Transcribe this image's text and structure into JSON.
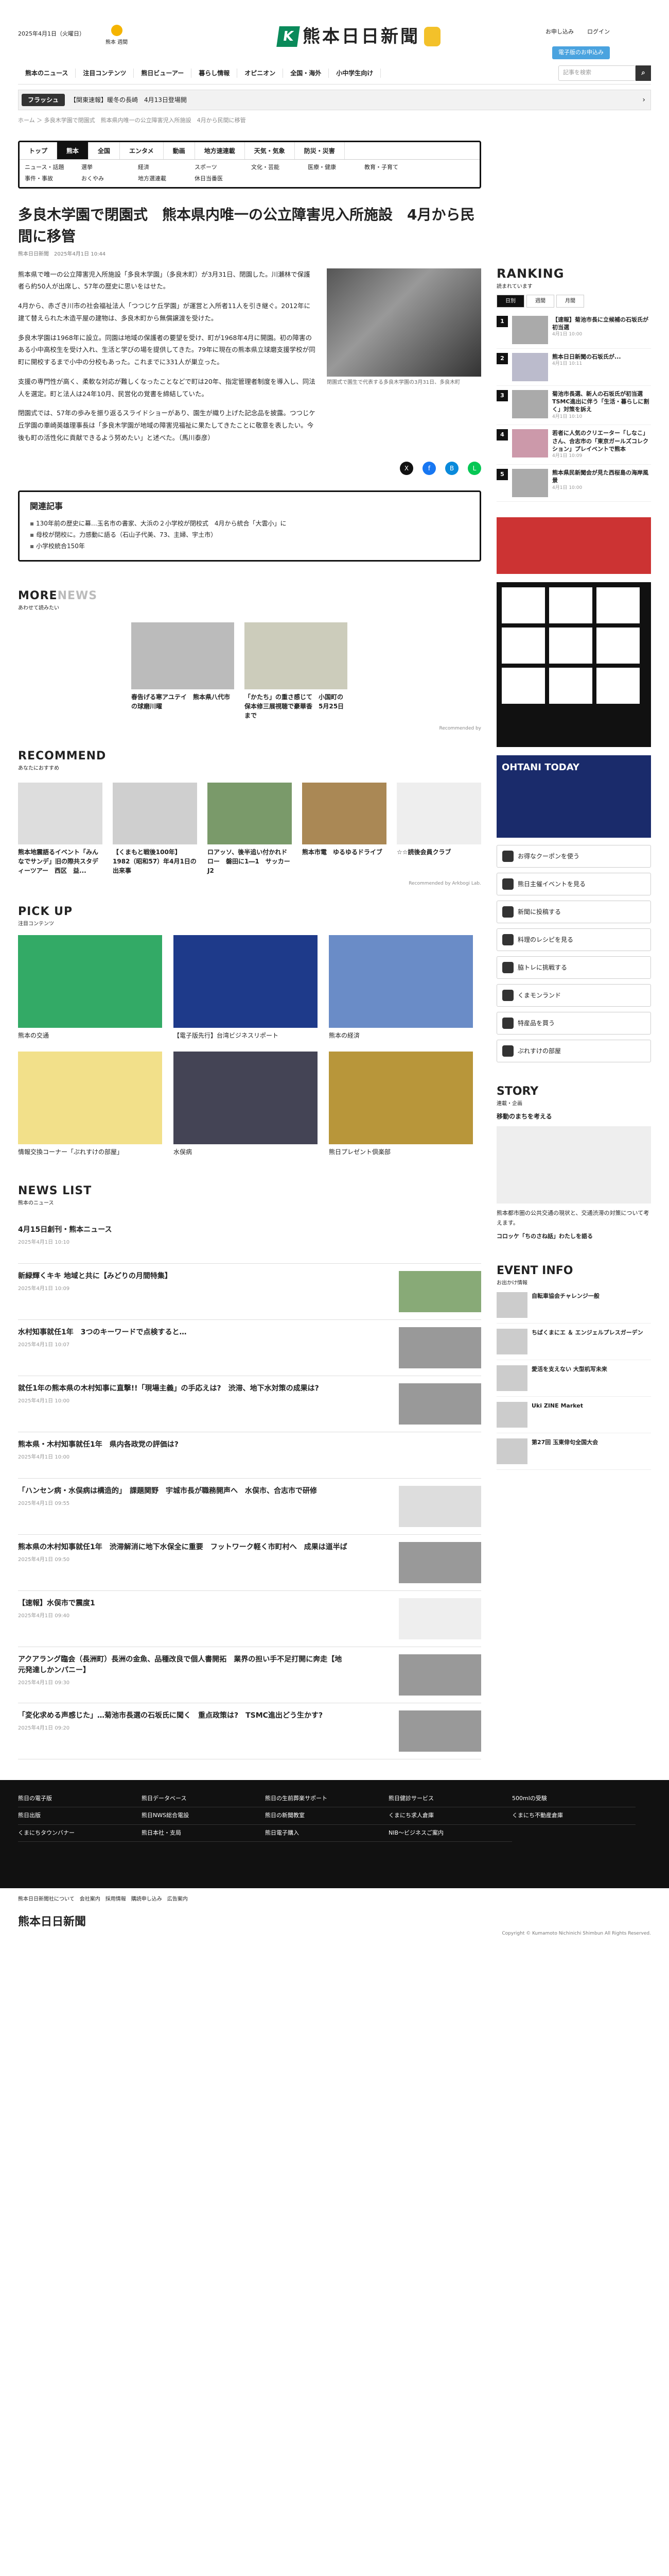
{
  "header": {
    "date": "2025年4月1日（火曜日）",
    "weather_city": "熊本",
    "weather_label": "週間",
    "logo_text": "熊本日日新聞",
    "link_login": "お申し込み",
    "link_member": "ログイン",
    "subscribe": "電子版のお申込み"
  },
  "nav": [
    "熊本のニュース",
    "注目コンテンツ",
    "熊日ビューアー",
    "暮らし情報",
    "オピニオン",
    "全国・海外",
    "小中学生向け"
  ],
  "search_placeholder": "記事を検索",
  "flash": {
    "label": "フラッシュ",
    "text": "【関東速報】暖冬の長崎　4月13日登場開"
  },
  "breadcrumb": "ホーム ＞ 多良木学園で閉園式　熊本県内唯一の公立障害児入所施設　4月から民間に移管",
  "cats": {
    "main": [
      "トップ",
      "熊本",
      "全国",
      "エンタメ",
      "動画",
      "地方速連載",
      "天気・気象",
      "防災・災害"
    ],
    "sub": [
      "ニュース・話題",
      "選挙",
      "経済",
      "スポーツ",
      "文化・芸能",
      "医療・健康",
      "教育・子育て",
      "事件・事故",
      "おくやみ",
      "地方選連載",
      "休日当番医"
    ]
  },
  "article": {
    "title": "多良木学園で閉園式　熊本県内唯一の公立障害児入所施設　4月から民間に移管",
    "meta": "熊本日日新聞　2025年4月1日 10:44",
    "paragraphs": [
      "熊本県で唯一の公立障害児入所施設「多良木学園」（多良木町）が3月31日、閉園した。川瀬林で保護者ら約50人が出席し、57年の歴史に思いをはせた。",
      "4月から、赤ざき川市の社会福祉法人「つつじケ丘学園」が運営と入所者11人を引き継ぐ。2012年に建て替えられた木造平屋の建物は、多良木町から無償譲渡を受けた。",
      "多良木学園は1968年に設立。同園は地域の保護者の要望を受け、町が1968年4月に開園。初の障害のある小中高校生を受け入れ、生活と学びの場を提供してきた。79年に現在の熊本県立球磨支援学校が同町に開校するまで小中の分校もあった。これまでに331人が巣立った。",
      "支援の専門性が高く、柔軟な対応が難しくなったことなどで町は20年、指定管理者制度を導入し、同法人を選定。町と法人は24年10月、民営化の覚書を締結していた。",
      "閉園式では、57年の歩みを振り返るスライドショーがあり、園生が織り上げた記念品を披露。つつじケ丘学園の車崎英雄理事長は「多良木学園が地域の障害児福祉に果たしてきたことに敬意を表したい。今後も町の活性化に貢献できるよう努めたい」と述べた。（馬川泰彦）"
    ],
    "photo_caption": "閉園式で園生で代表する多良木学園の3月31日、多良木町"
  },
  "related": {
    "title": "関連記事",
    "items": [
      "130年前の歴史に幕…玉名市の書家、大浜の２小学校が閉校式　4月から統合「大雲小」に",
      "母校が閉校に。力感動に語る（石山子代美、73、主婦、宇土市）",
      "小学校統合150年"
    ]
  },
  "more": {
    "title": "MORE",
    "title_light": "NEWS",
    "subtitle": "あわせて読みたい",
    "items": [
      {
        "title": "春告げる寒アユテイ　熊本県八代市の球磨川曜"
      },
      {
        "title": "「かたち」の重さ感じて　小国町の保本修三展視聴で豪華香　5月25日まで"
      }
    ],
    "credit": "Recommended by"
  },
  "recommend": {
    "title": "RECOMMEND",
    "subtitle": "あなたにおすすめ",
    "items": [
      {
        "title": "熊本地震語るイベント「みんなでサンデ」旧の際共スタディーツアー　西区　益..."
      },
      {
        "title": "【くまもと戦後100年】1982（昭和57）年4月1日の出来事"
      },
      {
        "title": "ロアッソ、後半追い付かれドロー　磐田に1―1　サッカーJ2"
      },
      {
        "title": "熊本市電　ゆるゆるドライブ"
      },
      {
        "title": "☆☆読後会員クラブ"
      }
    ],
    "credit": "Recommended by Arkbogi Lab."
  },
  "pickup": {
    "title": "PICK UP",
    "subtitle": "注目コンテンツ",
    "items": [
      "熊本の交通",
      "【電子版先行】台湾ビジネスリポート",
      "熊本の経済",
      "情報交換コーナー「ぷれすけの部屋」",
      "水俣病",
      "熊日プレゼント倶楽部"
    ]
  },
  "newslist": {
    "title": "NEWS LIST",
    "subtitle": "熊本のニュース",
    "items": [
      {
        "title": "4月15日創刊・熊本ニュース",
        "date": "2025年4月1日 10:10"
      },
      {
        "title": "新緑輝くキキ 地域と共に【みどりの月間特集】",
        "date": "2025年4月1日 10:09"
      },
      {
        "title": "水村知事就任1年　3つのキーワードで点検すると…",
        "date": "2025年4月1日 10:07"
      },
      {
        "title": "就任1年の熊本県の木村知事に直撃!!「現場主義」の手応えは?　渋滞、地下水対策の成果は?",
        "date": "2025年4月1日 10:00"
      },
      {
        "title": "熊本県・木村知事就任1年　県内各政党の評価は?",
        "date": "2025年4月1日 10:00"
      },
      {
        "title": "「ハンセン病・水俣病は構造的」　課題関野　宇城市長が職務開声へ　水俣市、合志市で研修",
        "date": "2025年4月1日 09:55"
      },
      {
        "title": "熊本県の木村知事就任1年　渋滞解消に地下水保全に重要　フットワーク軽く市町村へ　成果は道半ば",
        "date": "2025年4月1日 09:50"
      },
      {
        "title": "【速報】水俣市で震度1",
        "date": "2025年4月1日 09:40"
      },
      {
        "title": "アクアラング臨会（長洲町）長洲の金魚、品種改良で個人書開拓　業界の担い手不足打開に奔走【地元発達しかンパニー】",
        "date": "2025年4月1日 09:30"
      },
      {
        "title": "「変化求める声感じた」…菊池市長選の石坂氏に聞く　重点政策は?　TSMC進出どう生かす?",
        "date": "2025年4月1日 09:20"
      }
    ]
  },
  "ranking": {
    "title": "RANKING",
    "subtitle": "読まれています",
    "tabs": [
      "日別",
      "週間",
      "月間"
    ],
    "items": [
      {
        "title": "【速報】菊池市長に立候補の石坂氏が初当選",
        "date": "4月1日 10:00"
      },
      {
        "title": "熊本日日新聞の石坂氏が...",
        "date": "4月1日 10:11"
      },
      {
        "title": "菊池市長選、新人の石坂氏が初当選　TSMC進出に伴う「生活・暮らしに割く」対策を訴え",
        "date": "4月1日 10:10"
      },
      {
        "title": "若者に人気のクリエーター「しなこ」さん、合志市の「東京ガールズコレクション」プレイベントで熊本",
        "date": "4月1日 10:09"
      },
      {
        "title": "熊本県民新聞会が見た西桜島の海岸風景",
        "date": "4月1日 10:00"
      }
    ]
  },
  "otv": {
    "text": "OHTANI TODAY"
  },
  "menu": [
    "お得なクーポンを使う",
    "熊日主催イベントを見る",
    "新聞に投稿する",
    "料理のレシピを見る",
    "脇トレに挑戦する",
    "くまモンランド",
    "特産品を買う",
    "ぷれすけの部屋"
  ],
  "story": {
    "title": "STORY",
    "subtitle": "連載・企画",
    "head": "移動のまちを考える",
    "text": "熊本都市圏の公共交通の現状と、交通渋滞の対策について考えます。",
    "author": "コロッケ「ちのさね話」わたしを語る"
  },
  "event": {
    "title": "EVENT INFO",
    "subtitle": "お出かけ情報",
    "items": [
      "自転車協会チャレンジ一般",
      "ちばくまにエ ＆ エンジェルプレスガーデン",
      "愛活を支えない 大型机写未来",
      "Uki ZINE Market",
      "第27回 玉東俳句全国大会"
    ]
  },
  "footer": [
    "熊日の電子版",
    "熊日データベース",
    "熊日の生前葬楽サポート",
    "熊日健診サービス",
    "500mlの受験",
    "熊日出版",
    "熊日NWS総合電設",
    "熊日の新聞教室",
    "くまにち求人倉庫",
    "くまにち不動産倉庫",
    "くまにちタウンバナー",
    "熊日本社・支局",
    "熊日電子購入",
    "NIB～ビジネスご案内"
  ],
  "footer2": {
    "links": "熊本日日新聞社について　会社案内　採用情報　購読申し込み　広告案内",
    "logo": "熊本日日新聞",
    "copy": "Copyright © Kumamoto Nichinichi Shimbun All Rights Reserved."
  }
}
